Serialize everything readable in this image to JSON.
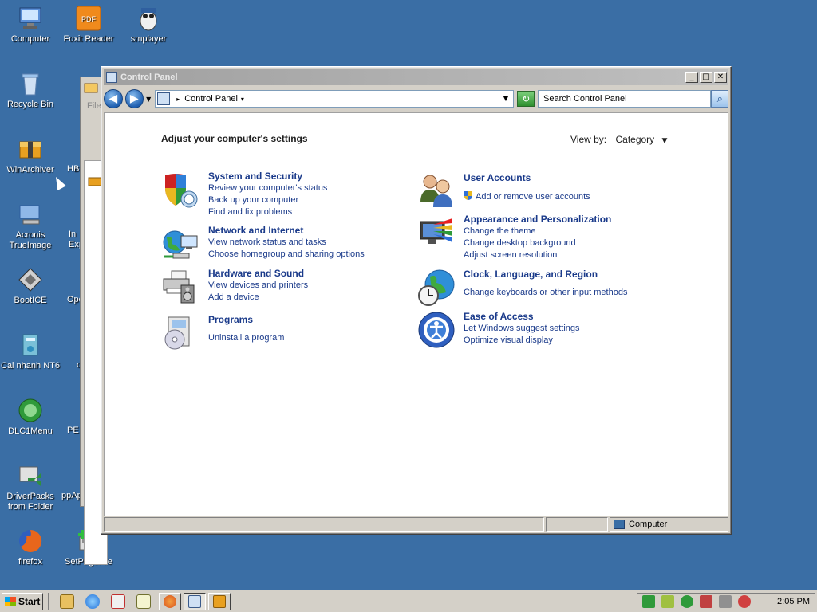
{
  "desktop": {
    "icons": [
      {
        "label": "Computer",
        "color": "#5a8fd8"
      },
      {
        "label": "Foxit Reader",
        "color": "#f08a1c"
      },
      {
        "label": "smplayer",
        "color": "#e0e0e0"
      },
      {
        "label": "Recycle Bin",
        "color": "#cfe0f4"
      },
      {
        "label": "WinArchiver",
        "color": "#e8a020"
      },
      {
        "label": "Acronis TrueImage",
        "color": "#8fb8e8"
      },
      {
        "label": "BootICE",
        "color": "#c0c0c0"
      },
      {
        "label": "Cai nhanh NT6",
        "color": "#7ac0d8"
      },
      {
        "label": "DLC1Menu",
        "color": "#2f9a3a"
      },
      {
        "label": "DriverPacks from Folder",
        "color": "#2f8f3f"
      },
      {
        "label": "firefox",
        "color": "#e8661c"
      },
      {
        "label": "SetPageFile",
        "color": "#e0e0e0"
      }
    ],
    "partial_labels": [
      "HB",
      "In Exp",
      "Ope",
      "c",
      "PE",
      "ppAp"
    ]
  },
  "background_window": {
    "file_menu": "File"
  },
  "window": {
    "title": "Control Panel",
    "buttons": {
      "minimize": "_",
      "maximize": "□",
      "close": "✕"
    },
    "address": {
      "breadcrumb": "Control Panel"
    },
    "search": {
      "placeholder": "Search Control Panel"
    },
    "heading": "Adjust your computer's settings",
    "view_by": {
      "label": "View by:",
      "value": "Category"
    },
    "categories_left": [
      {
        "title": "System and Security",
        "icon": "shield-icon",
        "links": [
          "Review your computer's status",
          "Back up your computer",
          "Find and fix problems"
        ]
      },
      {
        "title": "Network and Internet",
        "icon": "network-globe-icon",
        "links": [
          "View network status and tasks",
          "Choose homegroup and sharing options"
        ]
      },
      {
        "title": "Hardware and Sound",
        "icon": "printer-speaker-icon",
        "links": [
          "View devices and printers",
          "Add a device"
        ]
      },
      {
        "title": "Programs",
        "icon": "programs-disc-icon",
        "links": [
          "Uninstall a program"
        ]
      }
    ],
    "categories_right": [
      {
        "title": "User Accounts",
        "icon": "users-icon",
        "links": [
          "Add or remove user accounts"
        ]
      },
      {
        "title": "Appearance and Personalization",
        "icon": "display-palette-icon",
        "links": [
          "Change the theme",
          "Change desktop background",
          "Adjust screen resolution"
        ]
      },
      {
        "title": "Clock, Language, and Region",
        "icon": "clock-globe-icon",
        "links": [
          "Change keyboards or other input methods"
        ]
      },
      {
        "title": "Ease of Access",
        "icon": "accessibility-icon",
        "links": [
          "Let Windows suggest settings",
          "Optimize visual display"
        ]
      }
    ],
    "status": {
      "location": "Computer"
    }
  },
  "taskbar": {
    "start_label": "Start",
    "clock": "2:05 PM"
  },
  "colors": {
    "desktop": "#3a6ea5",
    "link": "#1a3a8a",
    "window_face": "#d4d0c8"
  }
}
